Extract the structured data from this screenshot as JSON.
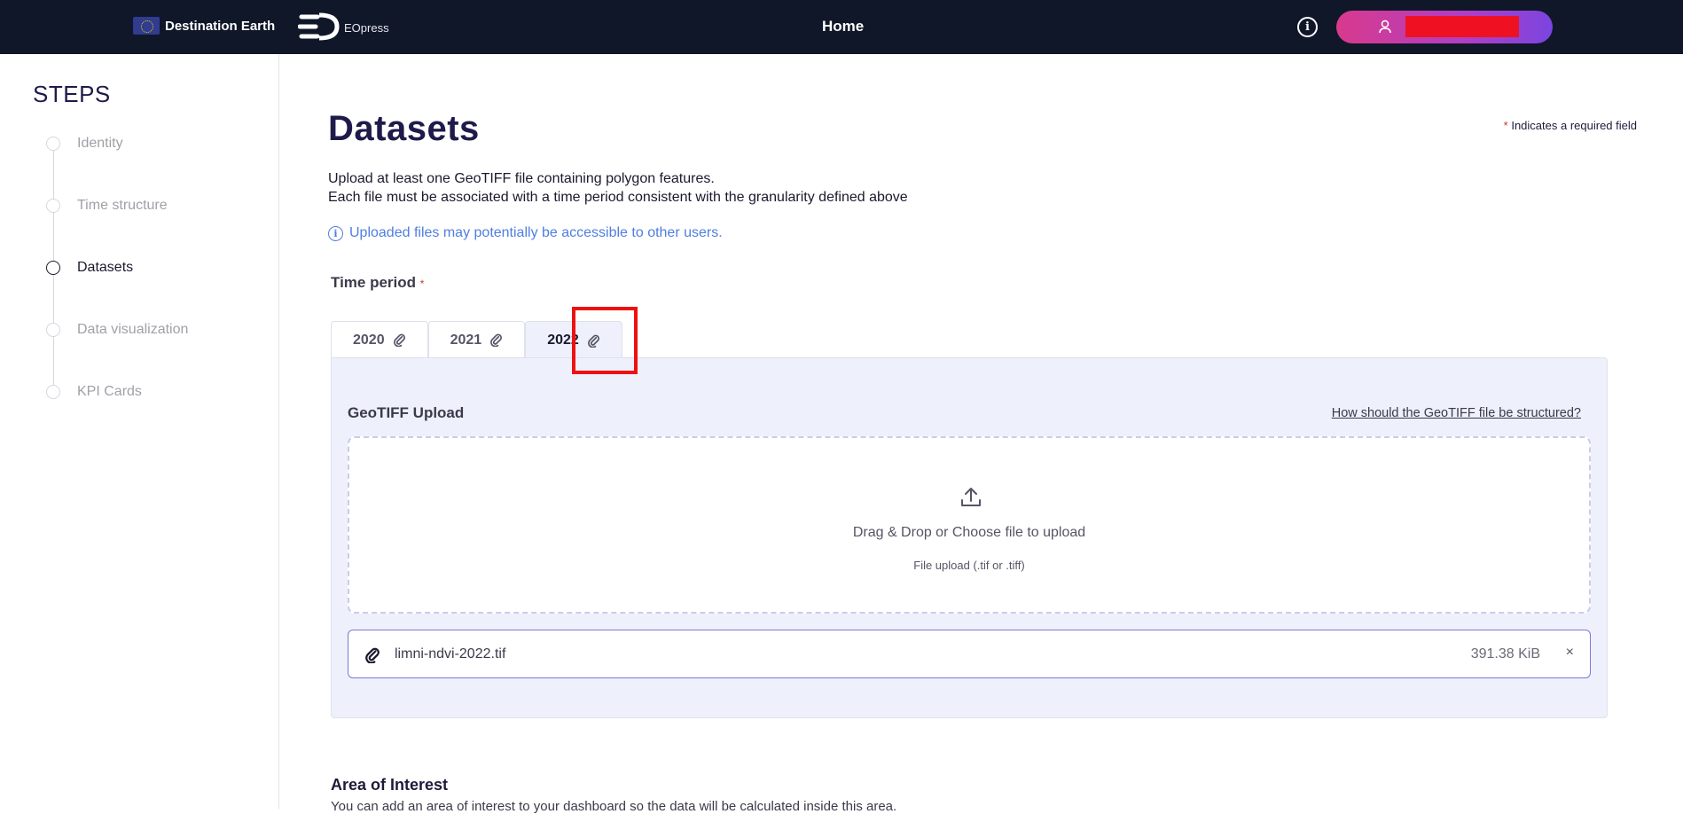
{
  "topbar": {
    "brand_destination": "Destination Earth",
    "brand_eopress": "EOpress",
    "nav_home": "Home",
    "info_icon": "info-icon",
    "user_icon": "user-icon"
  },
  "sidebar": {
    "title": "STEPS",
    "steps": [
      {
        "label": "Identity",
        "state": "inactive"
      },
      {
        "label": "Time structure",
        "state": "inactive"
      },
      {
        "label": "Datasets",
        "state": "active"
      },
      {
        "label": "Data visualization",
        "state": "inactive"
      },
      {
        "label": "KPI Cards",
        "state": "inactive"
      }
    ]
  },
  "main": {
    "title": "Datasets",
    "required_note_asterisk": "*",
    "required_note": "Indicates a required field",
    "desc_line1": "Upload at least one GeoTIFF file containing polygon features.",
    "desc_line2": "Each file must be associated with a time period consistent with the granularity defined above",
    "notice": "Uploaded files may potentially be accessible to other users.",
    "time_period_label": "Time period",
    "required_asterisk": "*",
    "tabs": [
      {
        "label": "2020",
        "icon": "paperclip-icon",
        "active": false
      },
      {
        "label": "2021",
        "icon": "paperclip-icon",
        "active": false
      },
      {
        "label": "2022",
        "icon": "paperclip-icon",
        "active": true
      }
    ],
    "upload": {
      "title": "GeoTIFF Upload",
      "help_link": "How should the GeoTIFF file be structured?",
      "dropzone_text": "Drag & Drop or Choose file to upload",
      "dropzone_sub": "File upload (.tif or .tiff)",
      "file": {
        "name": "limni-ndvi-2022.tif",
        "size": "391.38 KiB",
        "remove": "×"
      }
    },
    "aoi_title": "Area of Interest",
    "aoi_desc": "You can add an area of interest to your dashboard so the data will be calculated inside this area."
  },
  "colors": {
    "topbar_bg": "#0f1729",
    "accent_gradient_start": "#d83a8c",
    "accent_gradient_end": "#7a45e0",
    "notice_blue": "#4f7ee0",
    "panel_bg": "#eef0fc",
    "highlight": "#ee1111"
  }
}
